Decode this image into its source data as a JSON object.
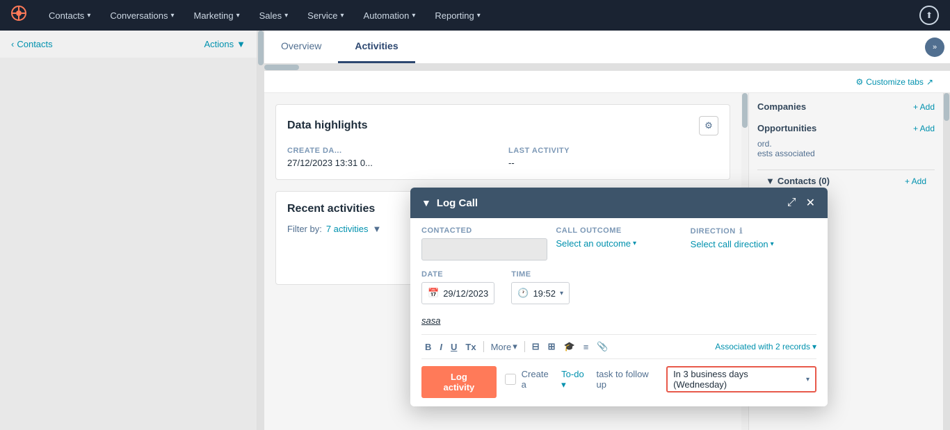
{
  "nav": {
    "logo": "☰",
    "items": [
      {
        "label": "Contacts",
        "id": "contacts"
      },
      {
        "label": "Conversations",
        "id": "conversations"
      },
      {
        "label": "Marketing",
        "id": "marketing"
      },
      {
        "label": "Sales",
        "id": "sales"
      },
      {
        "label": "Service",
        "id": "service"
      },
      {
        "label": "Automation",
        "id": "automation"
      },
      {
        "label": "Reporting",
        "id": "reporting"
      }
    ],
    "upload_icon": "⬆"
  },
  "sidebar": {
    "contacts_label": "Contacts",
    "actions_label": "Actions",
    "actions_chevron": "▼"
  },
  "tabs": {
    "overview_label": "Overview",
    "activities_label": "Activities",
    "expand_icon": "»"
  },
  "customize_tabs": {
    "label": "⚙ Customize tabs ↗"
  },
  "data_highlights": {
    "title": "Data highlights",
    "gear_icon": "⚙",
    "create_date_label": "CREATE DA...",
    "create_date_value": "27/12/2023 13:31 0...",
    "last_activity_label": "LAST ACTIVITY",
    "last_activity_value": "--"
  },
  "recent_activities": {
    "title": "Recent activities",
    "filter_label": "Filter by:",
    "activities_count": "7 activities",
    "activities_chevron": "▼",
    "empty_icon": "🔍"
  },
  "right_sidebar": {
    "companies_title": "Companies",
    "companies_add": "+ Add",
    "opportunities_title": "Opportunities",
    "opportunities_add": "+ Add",
    "opportunities_text": "ord.",
    "deals_text": "ests associated",
    "contacts_title": "Contacts (0)",
    "contacts_add": "+ Add",
    "contacts_chevron": "▼"
  },
  "log_call_modal": {
    "title": "Log Call",
    "collapse_icon": "▼",
    "expand_icon": "⤢",
    "close_icon": "✕",
    "contacted_label": "Contacted",
    "call_outcome_label": "Call outcome",
    "direction_label": "Direction",
    "direction_info": "ℹ",
    "select_outcome": "Select an outcome",
    "select_direction": "Select call direction",
    "chevron": "▾",
    "date_label": "Date",
    "time_label": "Time",
    "date_icon": "📅",
    "date_value": "29/12/2023",
    "time_icon": "🕐",
    "time_value": "19:52",
    "note_text": "sasa",
    "toolbar_bold": "B",
    "toolbar_italic": "I",
    "toolbar_underline": "U",
    "toolbar_tx": "Tx",
    "toolbar_more": "More",
    "toolbar_more_chevron": "▾",
    "toolbar_icon1": "⊟",
    "toolbar_icon2": "⊞",
    "toolbar_icon3": "🎓",
    "toolbar_icon4": "≡",
    "toolbar_icon5": "📎",
    "associated_label": "Associated with 2 records",
    "associated_chevron": "▾",
    "followup_text": "Create a",
    "followup_link": "To-do",
    "followup_link_chevron": "▾",
    "followup_text2": "task to follow up",
    "date_highlight": "In 3 business days (Wednesday)",
    "date_highlight_chevron": "▾",
    "log_button_label": "Log activity"
  }
}
